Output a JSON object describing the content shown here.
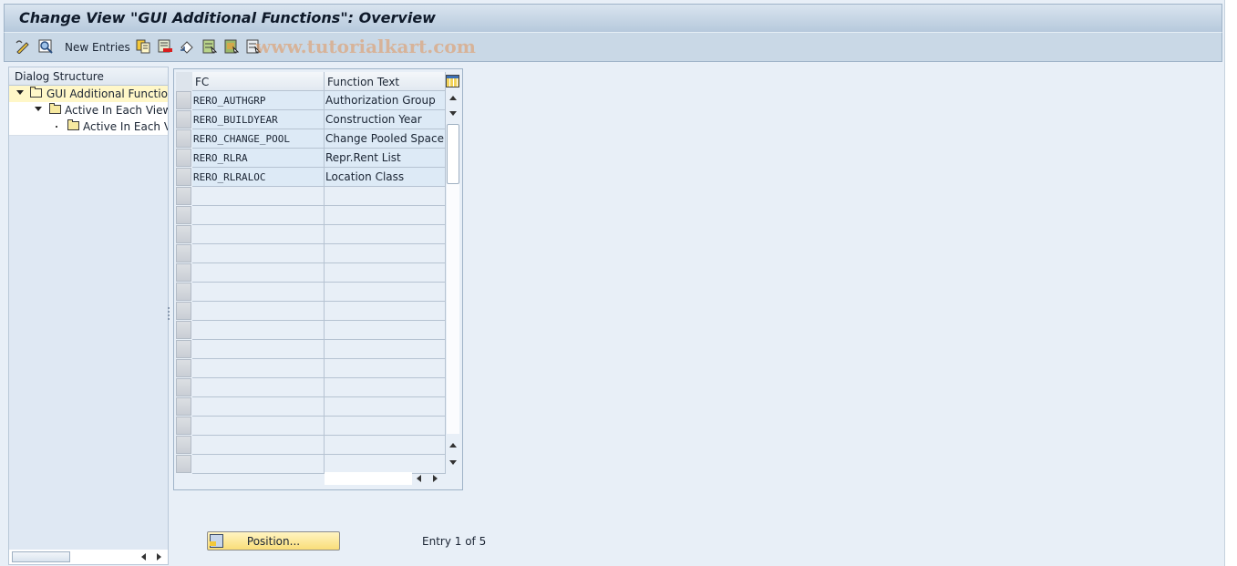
{
  "window": {
    "title": "Change View \"GUI Additional Functions\": Overview"
  },
  "toolbar": {
    "items": [
      {
        "name": "display-change-icon",
        "label": ""
      },
      {
        "name": "details-icon",
        "label": ""
      },
      {
        "name": "new-entries-button",
        "label": "New Entries"
      },
      {
        "name": "copy-as-icon",
        "label": ""
      },
      {
        "name": "delete-icon",
        "label": ""
      },
      {
        "name": "undo-change-icon",
        "label": ""
      },
      {
        "name": "select-all-icon",
        "label": ""
      },
      {
        "name": "select-block-icon",
        "label": ""
      },
      {
        "name": "deselect-all-icon",
        "label": ""
      }
    ],
    "new_entries_label": "New Entries",
    "watermark": "www.tutorialkart.com"
  },
  "dialog_structure": {
    "header": "Dialog Structure",
    "nodes": [
      {
        "label": "GUI Additional Functions",
        "level": 0,
        "expanded": true,
        "selected": true
      },
      {
        "label": "Active In Each View",
        "level": 1,
        "expanded": true,
        "selected": false
      },
      {
        "label": "Active In Each View",
        "level": 2,
        "expanded": false,
        "selected": false
      }
    ]
  },
  "table": {
    "columns": [
      "FC",
      "Function Text"
    ],
    "rows": [
      {
        "fc": "RERO_AUTHGRP",
        "text": "Authorization Group"
      },
      {
        "fc": "RERO_BUILDYEAR",
        "text": "Construction Year"
      },
      {
        "fc": "RERO_CHANGE_POOL",
        "text": "Change Pooled Space"
      },
      {
        "fc": "RERO_RLRA",
        "text": "Repr.Rent List"
      },
      {
        "fc": "RERO_RLRALOC",
        "text": "Location Class"
      }
    ],
    "empty_rows": 15
  },
  "footer": {
    "position_button": "Position...",
    "entry_info": "Entry 1 of 5"
  },
  "colors": {
    "background": "#e8eff7",
    "selected_node": "#fff7c8",
    "button_yellow": "#f9dd78",
    "filled_cell": "#ddeaf6"
  }
}
